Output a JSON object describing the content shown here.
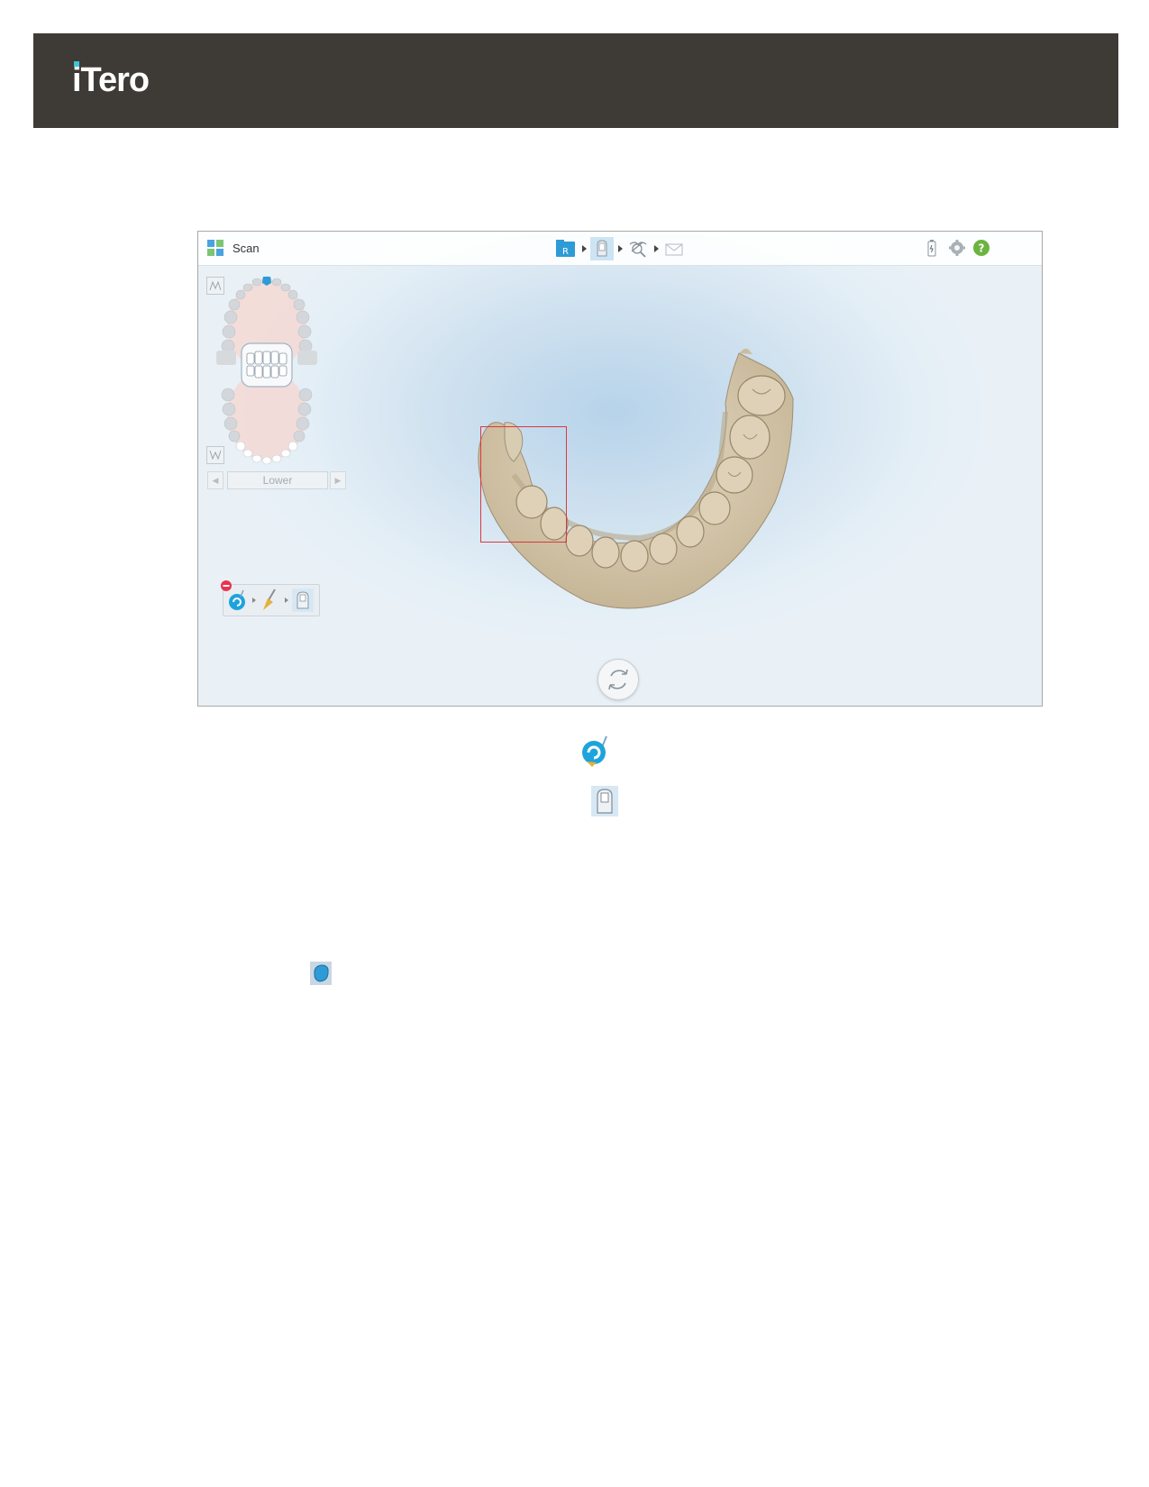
{
  "header": {
    "logo_text": "iTero"
  },
  "app": {
    "title": "Scan",
    "jaw_selector": {
      "value": "Lower"
    },
    "workflow": [
      "rx-icon",
      "scan-icon",
      "view-icon",
      "send-icon"
    ],
    "status_icons": [
      "battery-icon",
      "settings-gear-icon",
      "help-icon"
    ],
    "tool_tray": [
      "remove-segment-icon",
      "eraser-icon",
      "scan-mode-icon"
    ]
  },
  "colors": {
    "header_bg": "#3e3a35",
    "brand_accent": "#3ec6d6",
    "selection_box": "#d9393d",
    "model_color": "#d6c9b1",
    "help_green": "#6cb33f"
  }
}
